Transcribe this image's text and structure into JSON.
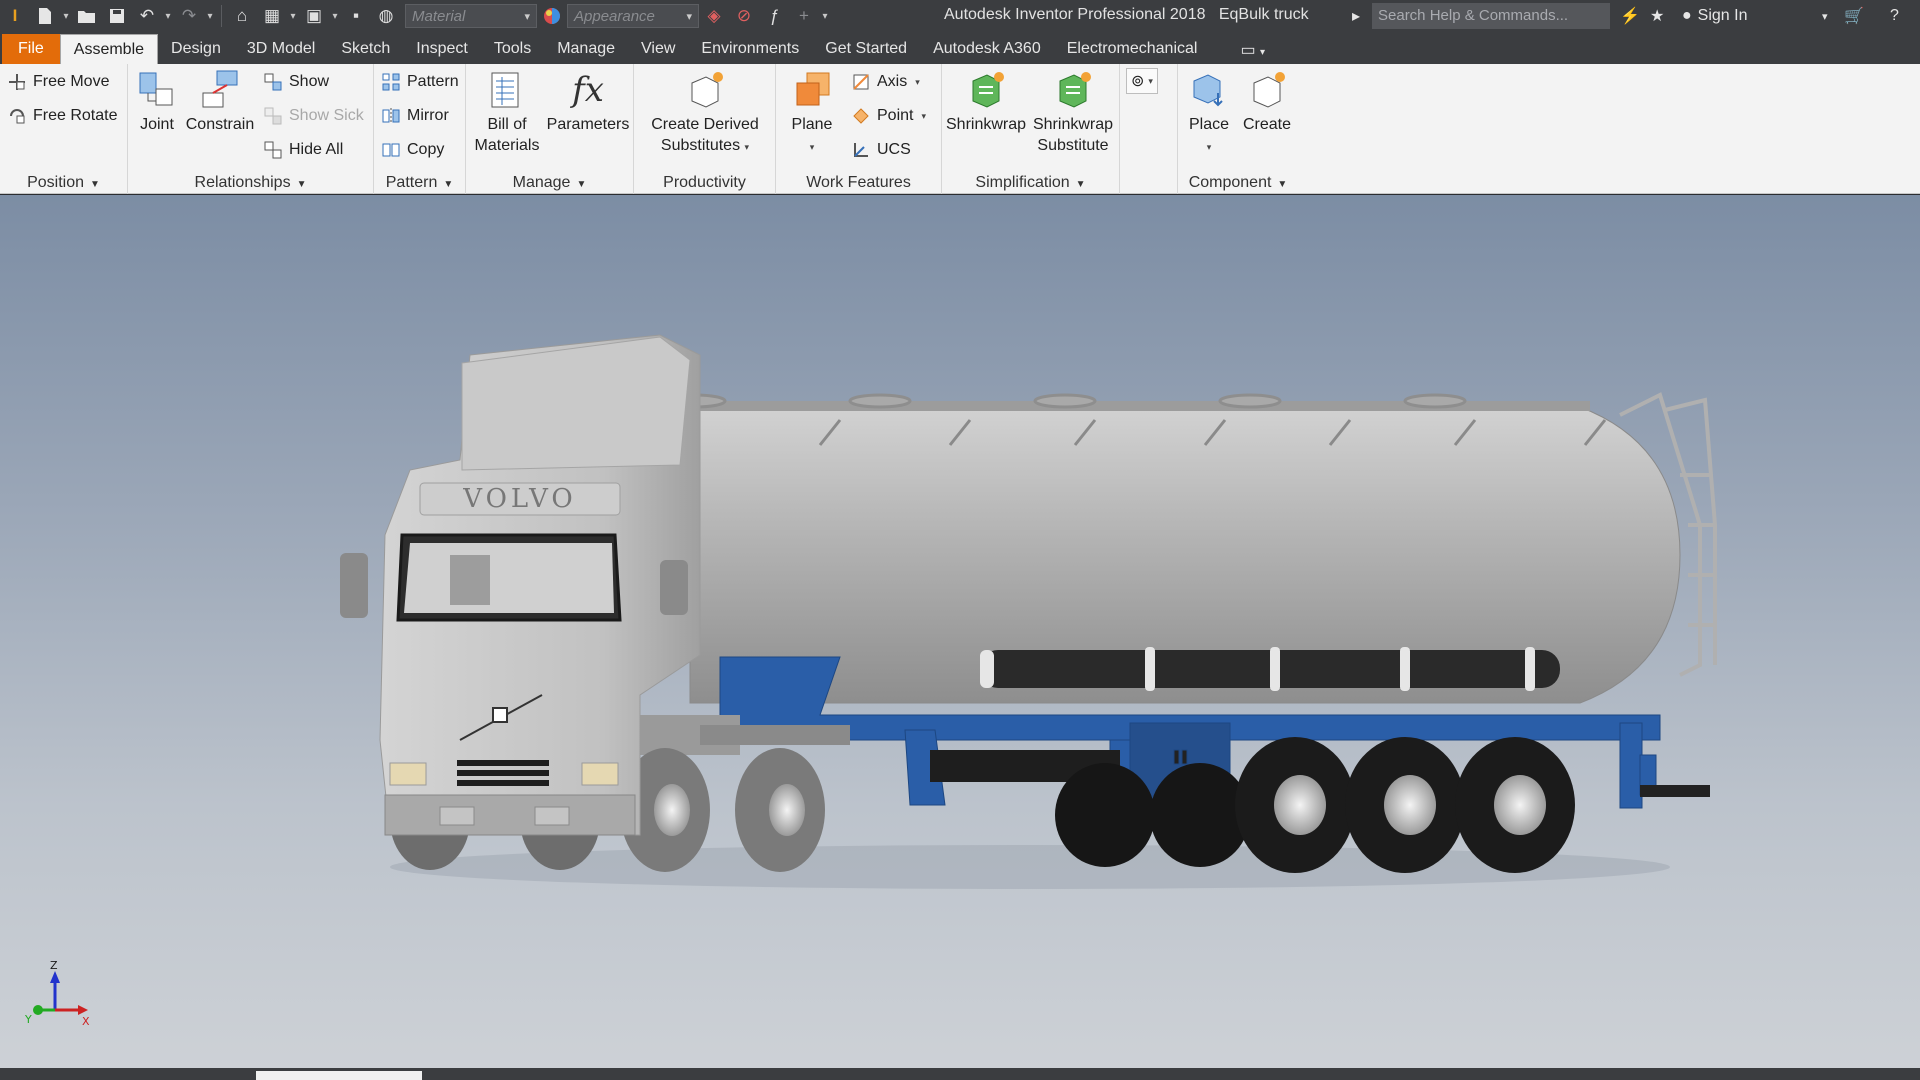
{
  "titlebar": {
    "material_placeholder": "Material",
    "appearance_placeholder": "Appearance",
    "app_title": "Autodesk Inventor Professional 2018",
    "document_name": "EqBulk truck",
    "search_placeholder": "Search Help & Commands...",
    "sign_in": "Sign In"
  },
  "tabs": [
    "File",
    "Assemble",
    "Design",
    "3D Model",
    "Sketch",
    "Inspect",
    "Tools",
    "Manage",
    "View",
    "Environments",
    "Get Started",
    "Autodesk A360",
    "Electromechanical"
  ],
  "active_tab": "Assemble",
  "ribbon": {
    "position": {
      "label": "Position",
      "free_move": "Free Move",
      "free_rotate": "Free Rotate"
    },
    "relationships": {
      "label": "Relationships",
      "joint": "Joint",
      "constrain": "Constrain",
      "show": "Show",
      "show_sick": "Show Sick",
      "hide_all": "Hide All"
    },
    "pattern": {
      "label": "Pattern",
      "pattern": "Pattern",
      "mirror": "Mirror",
      "copy": "Copy"
    },
    "manage": {
      "label": "Manage",
      "bom_line1": "Bill of",
      "bom_line2": "Materials",
      "parameters": "Parameters"
    },
    "productivity": {
      "label": "Productivity",
      "create_derived_line1": "Create Derived",
      "create_derived_line2": "Substitutes"
    },
    "work_features": {
      "label": "Work Features",
      "plane": "Plane",
      "axis": "Axis",
      "point": "Point",
      "ucs": "UCS"
    },
    "simplification": {
      "label": "Simplification",
      "shrinkwrap": "Shrinkwrap",
      "shrinkwrap_sub_line1": "Shrinkwrap",
      "shrinkwrap_sub_line2": "Substitute"
    },
    "component": {
      "label": "Component",
      "place": "Place",
      "create": "Create"
    }
  },
  "viewport": {
    "cab_brand": "VOLVO",
    "axis_labels": {
      "x": "X",
      "y": "Y",
      "z": "Z"
    }
  },
  "colors": {
    "file_tab": "#e36c0a",
    "chassis_blue": "#2a5ea8",
    "body_grey": "#b5b5b5"
  }
}
